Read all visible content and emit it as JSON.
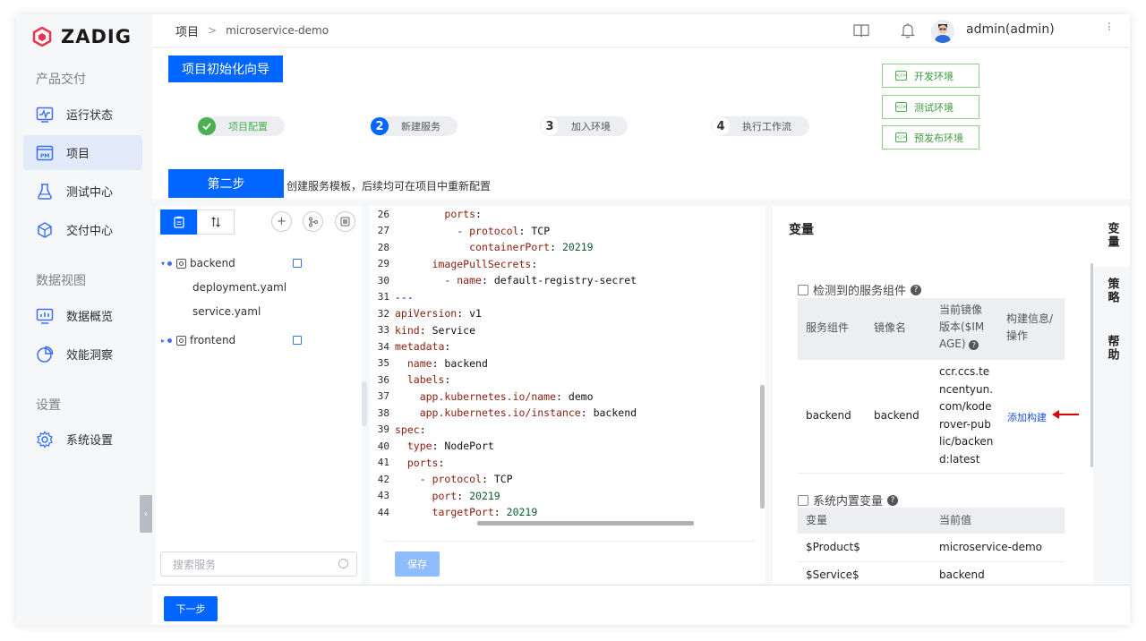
{
  "sidebar": {
    "brand": "ZADIG",
    "sections": [
      {
        "title": "产品交付",
        "items": [
          {
            "label": "运行状态",
            "icon": "monitor-pulse-icon"
          },
          {
            "label": "项目",
            "icon": "project-pm-icon",
            "active": true
          },
          {
            "label": "测试中心",
            "icon": "flask-icon"
          },
          {
            "label": "交付中心",
            "icon": "package-icon"
          }
        ]
      },
      {
        "title": "数据视图",
        "items": [
          {
            "label": "数据概览",
            "icon": "dashboard-icon"
          },
          {
            "label": "效能洞察",
            "icon": "pie-chart-icon"
          }
        ]
      },
      {
        "title": "设置",
        "items": [
          {
            "label": "系统设置",
            "icon": "gear-icon"
          }
        ]
      }
    ]
  },
  "header": {
    "breadcrumb": [
      "项目",
      "microservice-demo"
    ],
    "user": "admin(admin)"
  },
  "wizard": {
    "title": "项目初始化向导",
    "steps": [
      {
        "num": "",
        "label": "项目配置",
        "done": true
      },
      {
        "num": "2",
        "label": "新建服务",
        "current": true
      },
      {
        "num": "3",
        "label": "加入环境"
      },
      {
        "num": "4",
        "label": "执行工作流"
      }
    ],
    "envs": [
      "开发环境",
      "测试环境",
      "预发布环境"
    ],
    "step_badge": "第二步",
    "step_desc": "创建服务模板，后续均可在项目中重新配置"
  },
  "tree": {
    "services": [
      {
        "name": "backend",
        "files": [
          "deployment.yaml",
          "service.yaml"
        ],
        "expanded": true
      },
      {
        "name": "frontend",
        "files": [],
        "expanded": false
      }
    ],
    "search_placeholder": "搜索服务"
  },
  "editor": {
    "lines": [
      {
        "n": "26",
        "indent": "        ",
        "key": "ports",
        "sep": ":",
        "val": "",
        "dash": false
      },
      {
        "n": "27",
        "indent": "          ",
        "key": "protocol",
        "sep": ": ",
        "val": "TCP",
        "dash": true
      },
      {
        "n": "28",
        "indent": "            ",
        "key": "containerPort",
        "sep": ": ",
        "val": "20219",
        "dash": false,
        "valcls": "num"
      },
      {
        "n": "29",
        "indent": "      ",
        "key": "imagePullSecrets",
        "sep": ":",
        "val": "",
        "dash": false
      },
      {
        "n": "30",
        "indent": "        ",
        "key": "name",
        "sep": ": ",
        "val": "default-registry-secret",
        "dash": true
      },
      {
        "n": "31",
        "indent": "",
        "key": "",
        "sep": "",
        "val": "---",
        "dash": false,
        "valcls": "dash"
      },
      {
        "n": "32",
        "indent": "",
        "key": "apiVersion",
        "sep": ": ",
        "val": "v1",
        "dash": false
      },
      {
        "n": "33",
        "indent": "",
        "key": "kind",
        "sep": ": ",
        "val": "Service",
        "dash": false
      },
      {
        "n": "34",
        "indent": "",
        "key": "metadata",
        "sep": ":",
        "val": "",
        "dash": false
      },
      {
        "n": "35",
        "indent": "  ",
        "key": "name",
        "sep": ": ",
        "val": "backend",
        "dash": false
      },
      {
        "n": "36",
        "indent": "  ",
        "key": "labels",
        "sep": ":",
        "val": "",
        "dash": false
      },
      {
        "n": "37",
        "indent": "    ",
        "key": "app.kubernetes.io/name",
        "sep": ": ",
        "val": "demo",
        "dash": false
      },
      {
        "n": "38",
        "indent": "    ",
        "key": "app.kubernetes.io/instance",
        "sep": ": ",
        "val": "backend",
        "dash": false
      },
      {
        "n": "39",
        "indent": "",
        "key": "spec",
        "sep": ":",
        "val": "",
        "dash": false
      },
      {
        "n": "40",
        "indent": "  ",
        "key": "type",
        "sep": ": ",
        "val": "NodePort",
        "dash": false
      },
      {
        "n": "41",
        "indent": "  ",
        "key": "ports",
        "sep": ":",
        "val": "",
        "dash": false
      },
      {
        "n": "42",
        "indent": "    ",
        "key": "protocol",
        "sep": ": ",
        "val": "TCP",
        "dash": true
      },
      {
        "n": "43",
        "indent": "      ",
        "key": "port",
        "sep": ": ",
        "val": "20219",
        "dash": false,
        "valcls": "num"
      },
      {
        "n": "44",
        "indent": "      ",
        "key": "targetPort",
        "sep": ": ",
        "val": "20219",
        "dash": false,
        "valcls": "num"
      }
    ],
    "save_label": "保存"
  },
  "variables": {
    "title": "变量",
    "detected": {
      "title": "检测到的服务组件",
      "headers": [
        "服务组件",
        "镜像名",
        "当前镜像版本($IMAGE)",
        "构建信息/操作"
      ],
      "header_lines": {
        "image_version": [
          "当前镜像",
          "版本($IM",
          "AGE)"
        ],
        "build": [
          "构建信息/",
          "操作"
        ]
      },
      "rows": [
        {
          "component": "backend",
          "image": "backend",
          "version_lines": [
            "ccr.ccs.te",
            "ncentyun.",
            "com/kode",
            "rover-pub",
            "lic/backen",
            "d:latest"
          ],
          "action": "添加构建"
        }
      ]
    },
    "builtin": {
      "title": "系统内置变量",
      "headers": [
        "变量",
        "当前值"
      ],
      "rows": [
        {
          "name": "$Product$",
          "value": "microservice-demo"
        },
        {
          "name": "$Service$",
          "value": "backend"
        }
      ]
    }
  },
  "side_tabs": [
    "变量",
    "策略",
    "帮助"
  ],
  "bottom": {
    "next_label": "下一步"
  },
  "colors": {
    "primary": "#0066ff",
    "env_green": "#3a9a3a",
    "sidebar_active": "#e3ebfb"
  }
}
